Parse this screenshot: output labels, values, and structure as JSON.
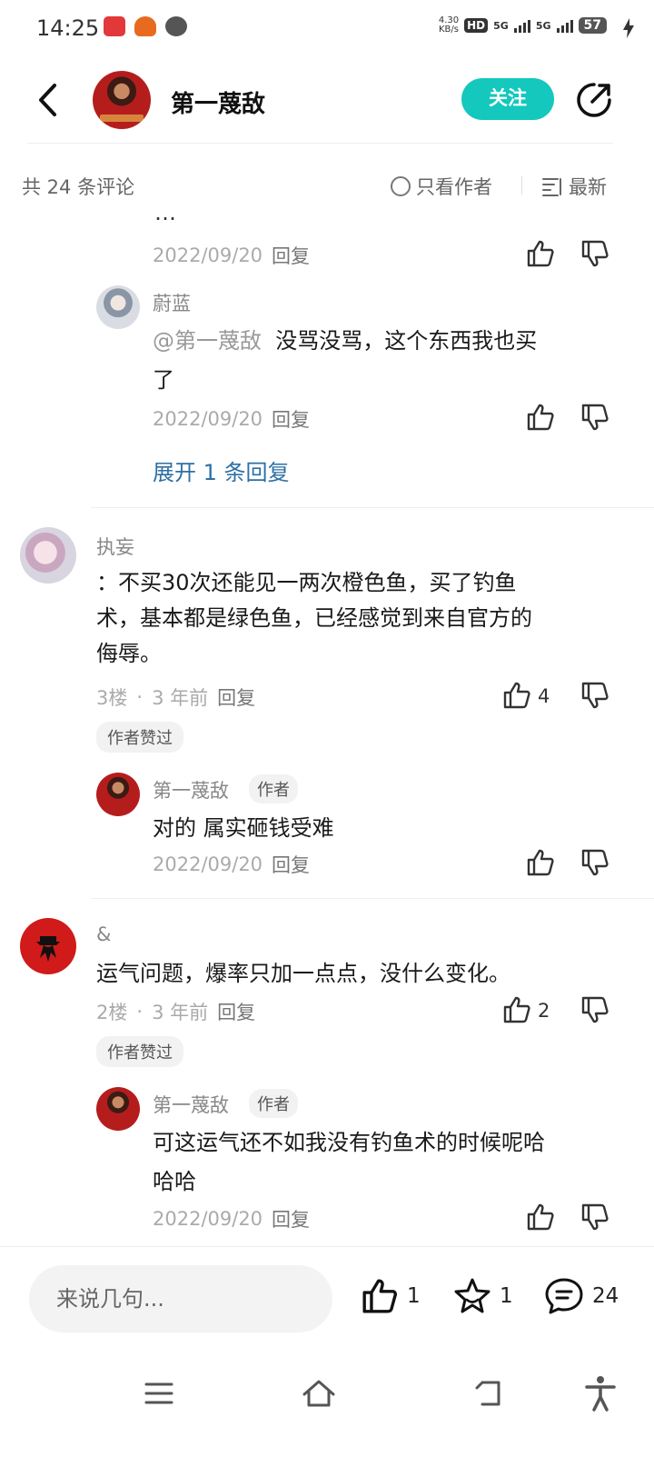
{
  "status_bar": {
    "time": "14:25",
    "net_speed_value": "4.30",
    "net_speed_unit": "KB/s",
    "hd_label": "HD",
    "signal1_label": "5G",
    "signal2_label": "5G",
    "battery": "57"
  },
  "header": {
    "author_name": "第一蔑敌",
    "follow_label": "关注"
  },
  "filter": {
    "comment_count": "共 24 条评论",
    "only_author_label": "只看作者",
    "sort_label": "最新"
  },
  "comments": {
    "c0": {
      "partial_text": "…",
      "date": "2022/09/20",
      "reply_label": "回复"
    },
    "c0_reply": {
      "user": "蔚蓝",
      "mention": "@第一蔑敌",
      "text_line1": "没骂没骂，这个东西我也买",
      "text_line2": "了",
      "date": "2022/09/20",
      "reply_label": "回复"
    },
    "c0_expand": "展开 1 条回复",
    "c3": {
      "user": "执妄",
      "text_line1": "：不买30次还能见一两次橙色鱼，买了钓鱼",
      "text_line2": "术，基本都是绿色鱼，已经感觉到来自官方的",
      "text_line3": "侮辱。",
      "floor": "3楼",
      "dot": "·",
      "time_ago": "3 年前",
      "reply_label": "回复",
      "like_count": "4",
      "liked_tag": "作者赞过"
    },
    "c3_reply": {
      "user": "第一蔑敌",
      "author_tag": "作者",
      "text": "对的 属实砸钱受难",
      "date": "2022/09/20",
      "reply_label": "回复"
    },
    "c2": {
      "user": "&",
      "text": "运气问题，爆率只加一点点，没什么变化。",
      "floor": "2楼",
      "dot": "·",
      "time_ago": "3 年前",
      "reply_label": "回复",
      "like_count": "2",
      "liked_tag": "作者赞过"
    },
    "c2_reply": {
      "user": "第一蔑敌",
      "author_tag": "作者",
      "text_line1": "可这运气还不如我没有钓鱼术的时候呢哈",
      "text_line2": "哈哈",
      "date": "2022/09/20",
      "reply_label": "回复"
    }
  },
  "bottom_bar": {
    "input_placeholder": "来说几句...",
    "like_count": "1",
    "fav_count": "1",
    "comment_count": "24"
  },
  "colors": {
    "accent": "#14c8bd",
    "link": "#2d6fa3"
  },
  "icons": [
    "back-arrow-icon",
    "share-icon",
    "thumb-up-icon",
    "thumb-down-icon",
    "star-icon",
    "comment-icon",
    "menu-icon",
    "home-icon",
    "back-nav-icon",
    "accessibility-icon"
  ]
}
